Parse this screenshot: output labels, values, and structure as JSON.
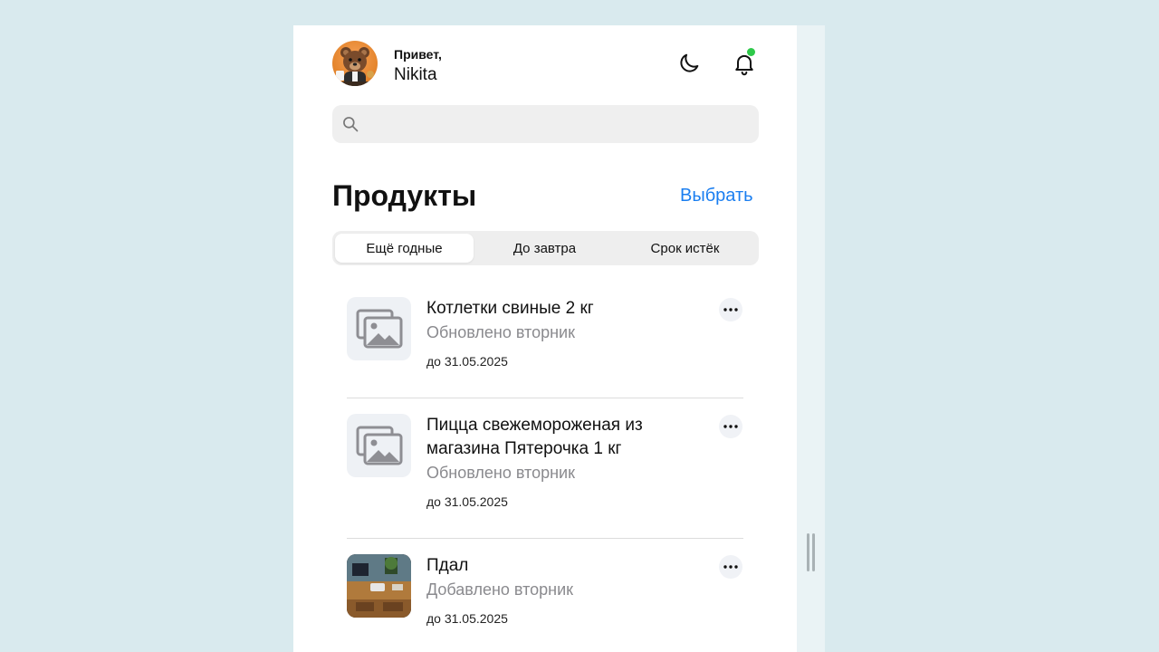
{
  "header": {
    "greeting": "Привет,",
    "user_name": "Nikita",
    "notification_dot_color": "#2ec94a"
  },
  "search": {
    "placeholder": "",
    "value": ""
  },
  "section": {
    "title": "Продукты",
    "select_label": "Выбрать",
    "accent_color": "#1a7ef0"
  },
  "tabs": [
    {
      "label": "Ещё годные",
      "active": true
    },
    {
      "label": "До завтра",
      "active": false
    },
    {
      "label": "Срок истёк",
      "active": false
    }
  ],
  "products": [
    {
      "title": "Котлетки свиные 2 кг",
      "subtitle": "Обновлено вторник",
      "date": "до 31.05.2025",
      "thumbnail": "image-placeholder-icon"
    },
    {
      "title": "Пицца свежемороженая из магазина Пятерочка 1 кг",
      "subtitle": "Обновлено вторник",
      "date": "до 31.05.2025",
      "thumbnail": "image-placeholder-icon"
    },
    {
      "title": "Пдал",
      "subtitle": "Добавлено вторник",
      "date": "до 31.05.2025",
      "thumbnail": "photo"
    }
  ]
}
